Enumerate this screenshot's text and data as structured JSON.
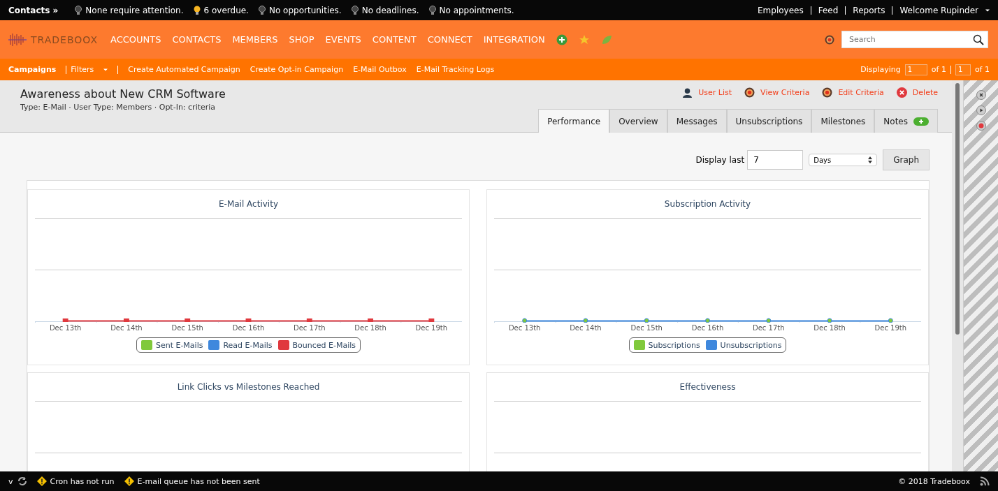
{
  "top_bar": {
    "section": "Contacts »",
    "alerts": [
      {
        "text": "None require attention.",
        "kind": "idle"
      },
      {
        "text": "6 overdue.",
        "kind": "lit"
      },
      {
        "text": "No opportunities.",
        "kind": "idle"
      },
      {
        "text": "No deadlines.",
        "kind": "idle"
      },
      {
        "text": "No appointments.",
        "kind": "idle"
      }
    ],
    "links": [
      {
        "label": "Employees",
        "kind": "link"
      },
      {
        "label": "Feed",
        "kind": "link"
      },
      {
        "label": "Reports",
        "kind": "link"
      },
      {
        "label": "Welcome Rupinder",
        "kind": "dropdown"
      }
    ]
  },
  "nav": {
    "logo": "TRADEBOOX",
    "items": [
      "ACCOUNTS",
      "CONTACTS",
      "MEMBERS",
      "SHOP",
      "EVENTS",
      "CONTENT",
      "CONNECT",
      "INTEGRATION"
    ],
    "search": {
      "placeholder": "Search"
    }
  },
  "sub_nav": {
    "items": [
      {
        "label": "Campaigns",
        "selected": true,
        "kind": "link"
      },
      {
        "label": "Filters",
        "selected": false,
        "kind": "dropdown"
      },
      {
        "label": "Create Automated Campaign",
        "selected": false,
        "kind": "link"
      },
      {
        "label": "Create Opt-in Campaign",
        "selected": false,
        "kind": "link"
      },
      {
        "label": "E-Mail Outbox",
        "selected": false,
        "kind": "link"
      },
      {
        "label": "E-Mail Tracking Logs",
        "selected": false,
        "kind": "link"
      }
    ],
    "displaying": {
      "label": "Displaying",
      "page": "1",
      "of": "of 1",
      "page_2": "1",
      "of_2": "of 1"
    }
  },
  "campaign": {
    "title": "Awareness about New CRM Software",
    "meta": "Type: E-Mail · User Type: Members · Opt-In: criteria",
    "actions": [
      {
        "label": "User List",
        "kind": "user"
      },
      {
        "label": "View Criteria",
        "kind": "target"
      },
      {
        "label": "Edit Criteria",
        "kind": "target"
      },
      {
        "label": "Delete",
        "kind": "delete"
      }
    ],
    "tabs": [
      {
        "label": "Performance",
        "selected": true,
        "kind": "plain"
      },
      {
        "label": "Overview",
        "selected": false,
        "kind": "plain"
      },
      {
        "label": "Messages",
        "selected": false,
        "kind": "plain"
      },
      {
        "label": "Unsubscriptions",
        "selected": false,
        "kind": "plain"
      },
      {
        "label": "Milestones",
        "selected": false,
        "kind": "plain"
      },
      {
        "label": "Notes",
        "selected": false,
        "kind": "add"
      }
    ]
  },
  "display_last": {
    "label": "Display last",
    "value": "7",
    "unit": "Days",
    "button": "Graph"
  },
  "charts": [
    {
      "title": "E-Mail Activity",
      "kind": "square",
      "x_labels": [
        "Dec 13th",
        "Dec 14th",
        "Dec 15th",
        "Dec 16th",
        "Dec 17th",
        "Dec 18th",
        "Dec 19th"
      ],
      "legend": [
        {
          "label": "Sent E-Mails",
          "color": "#80c93c"
        },
        {
          "label": "Read E-Mails",
          "color": "#3f88dd"
        },
        {
          "label": "Bounced E-Mails",
          "color": "#e0393e"
        }
      ]
    },
    {
      "title": "Subscription Activity",
      "kind": "dot",
      "x_labels": [
        "Dec 13th",
        "Dec 14th",
        "Dec 15th",
        "Dec 16th",
        "Dec 17th",
        "Dec 18th",
        "Dec 19th"
      ],
      "legend": [
        {
          "label": "Subscriptions",
          "color": "#80c93c"
        },
        {
          "label": "Unsubscriptions",
          "color": "#3f88dd"
        }
      ]
    },
    {
      "title": "Link Clicks vs Milestones Reached",
      "kind": "cut"
    },
    {
      "title": "Effectiveness",
      "kind": "cut"
    }
  ],
  "footer": {
    "version": "v",
    "alerts": [
      "Cron has not run",
      "E-mail queue has not been sent"
    ],
    "copyright": "© 2018 Tradeboox"
  }
}
